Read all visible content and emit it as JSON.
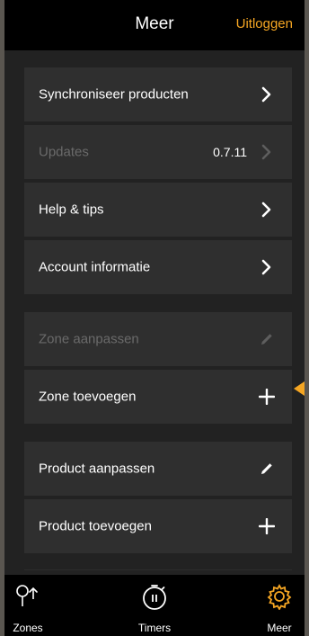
{
  "header": {
    "title": "Meer",
    "logout_label": "Uitloggen"
  },
  "menu": {
    "sync_products": {
      "label": "Synchroniseer producten",
      "icon": "chevron-right-icon"
    },
    "updates": {
      "label": "Updates",
      "value": "0.7.11",
      "disabled": true,
      "icon": "chevron-right-icon"
    },
    "help": {
      "label": "Help & tips",
      "icon": "chevron-right-icon"
    },
    "account": {
      "label": "Account informatie",
      "icon": "chevron-right-icon"
    },
    "edit_zone": {
      "label": "Zone aanpassen",
      "disabled": true,
      "icon": "pencil-icon"
    },
    "add_zone": {
      "label": "Zone toevoegen",
      "icon": "plus-icon"
    },
    "edit_product": {
      "label": "Product aanpassen",
      "icon": "pencil-icon"
    },
    "add_product": {
      "label": "Product toevoegen",
      "icon": "plus-icon"
    }
  },
  "tabbar": {
    "tabs": [
      {
        "label": "Zones",
        "icon": "zones-icon"
      },
      {
        "label": "Timers",
        "icon": "timer-icon"
      },
      {
        "label": "Meer",
        "icon": "gear-icon",
        "active": true
      }
    ]
  },
  "colors": {
    "accent": "#f5a623",
    "background": "#222222",
    "row": "#2f2f2f",
    "disabled_text": "#6a6a6a"
  }
}
